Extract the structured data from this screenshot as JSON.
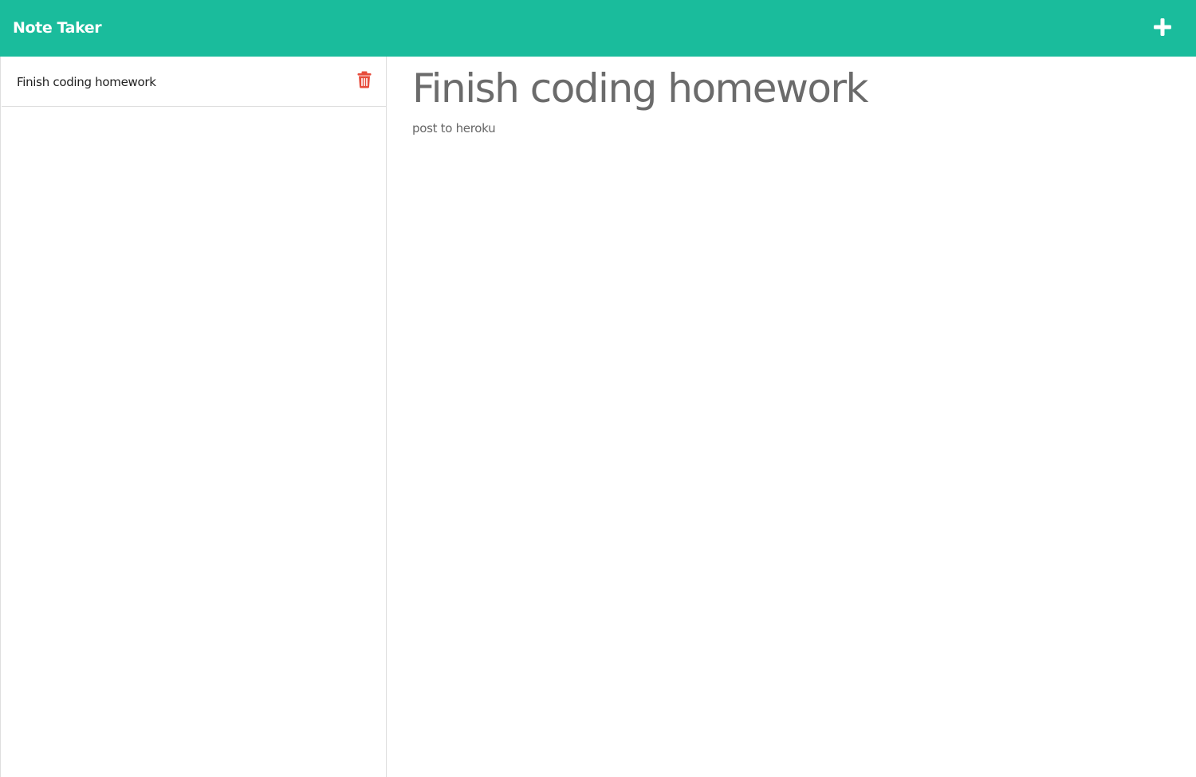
{
  "navbar": {
    "brand": "Note Taker",
    "new_note_icon": "plus-icon",
    "background_color": "#1abc9c"
  },
  "sidebar": {
    "notes": [
      {
        "title": "Finish coding homework",
        "delete_icon": "trash-icon",
        "delete_color": "#e74c3c"
      }
    ]
  },
  "editor": {
    "title": "Finish coding homework",
    "text": "post to heroku"
  }
}
